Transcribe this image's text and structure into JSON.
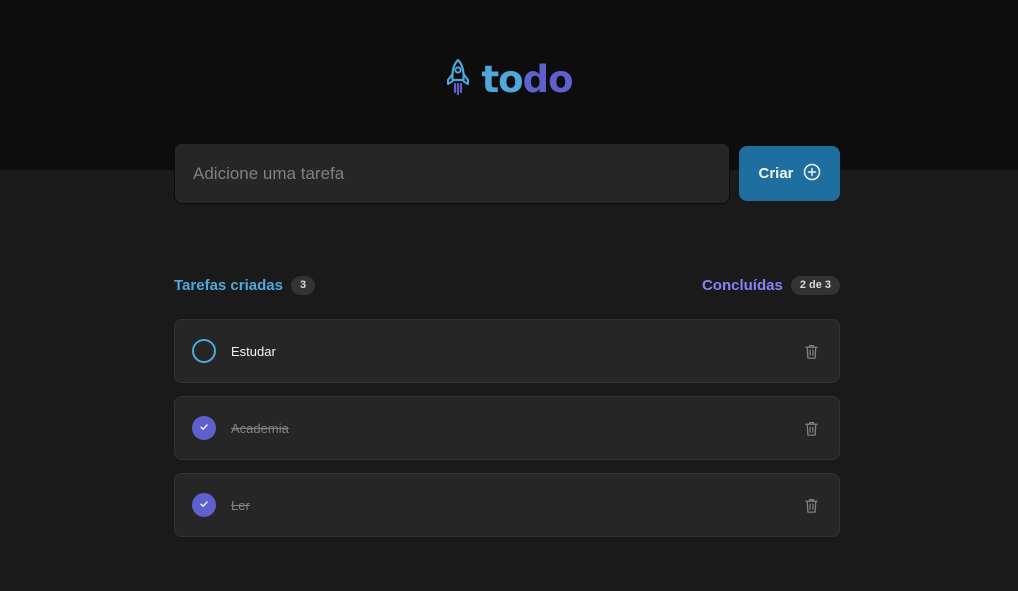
{
  "logo": {
    "text_part1": "to",
    "text_part2": "do"
  },
  "new_task": {
    "placeholder": "Adicione uma tarefa",
    "button_label": "Criar"
  },
  "summary": {
    "created_label": "Tarefas criadas",
    "created_count": "3",
    "done_label": "Concluídas",
    "done_count": "2 de 3"
  },
  "tasks": [
    {
      "text": "Estudar",
      "completed": false
    },
    {
      "text": "Academia",
      "completed": true
    },
    {
      "text": "Ler",
      "completed": true
    }
  ],
  "colors": {
    "blue": "#4ea8de",
    "purple": "#5e60ce",
    "purple_light": "#8284fa",
    "button": "#1e6f9f"
  },
  "icons": {
    "logo": "rocket-icon",
    "create": "plus-circle-icon",
    "check": "check-icon",
    "delete": "trash-icon"
  }
}
